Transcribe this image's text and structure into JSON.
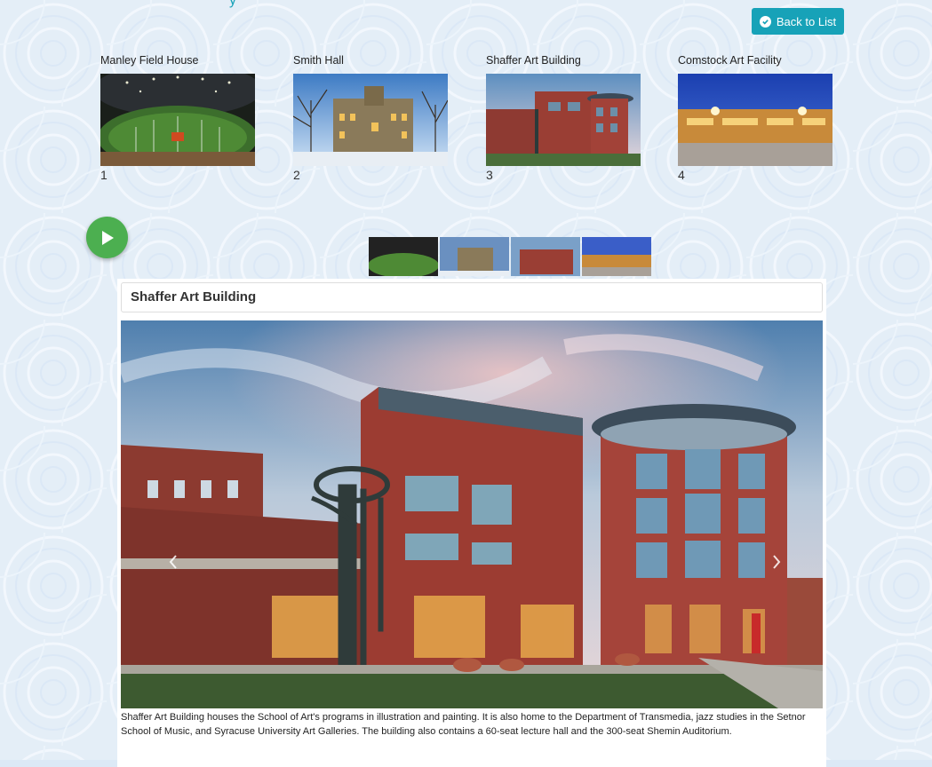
{
  "header": {
    "clipped_title": "y",
    "back_label": "Back to List"
  },
  "gallery": [
    {
      "label": "Manley Field House",
      "number": "1"
    },
    {
      "label": "Smith Hall",
      "number": "2"
    },
    {
      "label": "Shaffer Art Building",
      "number": "3"
    },
    {
      "label": "Comstock Art Facility",
      "number": "4"
    }
  ],
  "slideshow": {
    "title": "Shaffer Art Building",
    "description": "Shaffer Art Building houses the School of Art's programs in illustration and painting. It is also home to the Department of Transmedia, jazz studies in the Setnor School of Music, and Syracuse University Art Galleries. The building also contains a 60-seat lecture hall and the 300-seat Shemin Auditorium."
  },
  "colors": {
    "accent": "#17a2b8",
    "play": "#4caf50",
    "background": "#dce9f6"
  }
}
